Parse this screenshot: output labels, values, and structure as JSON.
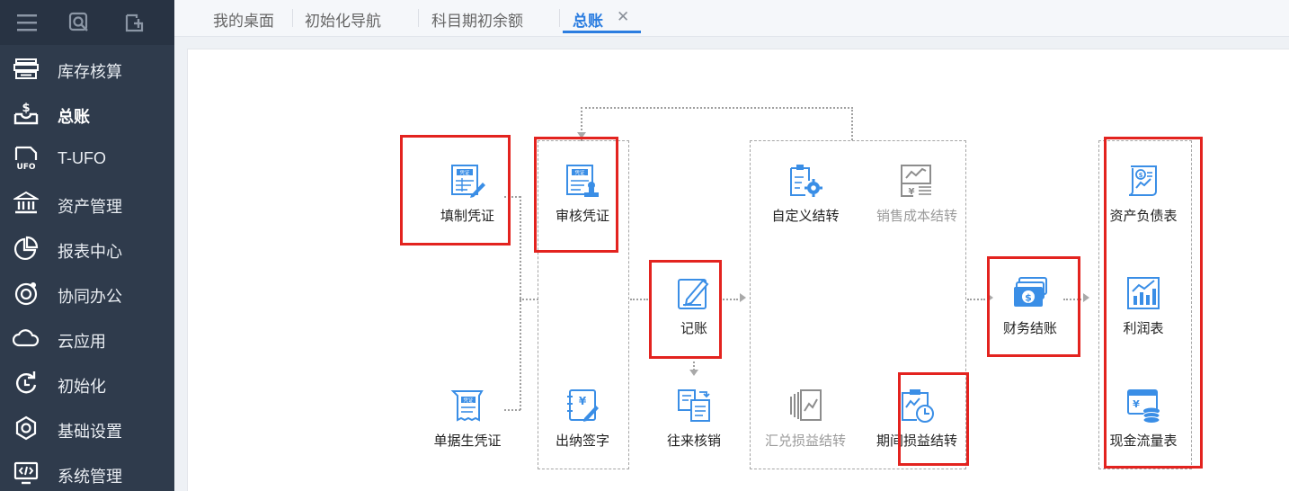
{
  "sidebar": {
    "top_icons": [
      "menu-icon",
      "search-icon",
      "add-page-icon"
    ],
    "items": [
      {
        "label": "库存核算",
        "icon": "inventory-icon"
      },
      {
        "label": "总账",
        "icon": "ledger-icon"
      },
      {
        "label": "T-UFO",
        "icon": "ufo-icon"
      },
      {
        "label": "资产管理",
        "icon": "bank-icon"
      },
      {
        "label": "报表中心",
        "icon": "pie-chart-icon"
      },
      {
        "label": "协同办公",
        "icon": "collab-icon"
      },
      {
        "label": "云应用",
        "icon": "cloud-icon"
      },
      {
        "label": "初始化",
        "icon": "refresh-icon"
      },
      {
        "label": "基础设置",
        "icon": "gear-icon"
      },
      {
        "label": "系统管理",
        "icon": "monitor-code-icon"
      }
    ],
    "active_item": "总账"
  },
  "tabs": [
    {
      "label": "我的桌面"
    },
    {
      "label": "初始化导航"
    },
    {
      "label": "科目期初余额"
    },
    {
      "label": "总账"
    }
  ],
  "active_tab": "总账",
  "tab_close": "✕",
  "flow": {
    "nodes": {
      "fill_voucher": {
        "label": "填制凭证",
        "badge": "凭证"
      },
      "review_voucher": {
        "label": "审核凭证",
        "badge": "凭证"
      },
      "bill_voucher": {
        "label": "单据生凭证",
        "badge": "凭证"
      },
      "cashier_sign": {
        "label": "出纳签字",
        "badge": "¥"
      },
      "post": {
        "label": "记账"
      },
      "reconcile": {
        "label": "往来核销"
      },
      "custom_carry": {
        "label": "自定义结转"
      },
      "sales_cost_carry": {
        "label": "销售成本结转",
        "badge": "¥"
      },
      "fx_carry": {
        "label": "汇兑损益结转"
      },
      "pl_carry": {
        "label": "期间损益结转"
      },
      "close": {
        "label": "财务结账",
        "badge": "$"
      },
      "balance_sheet": {
        "label": "资产负债表",
        "badge": "$"
      },
      "income_statement": {
        "label": "利润表"
      },
      "cashflow": {
        "label": "现金流量表",
        "badge": "¥"
      }
    }
  },
  "colors": {
    "sidebar_bg": "#2f3b4c",
    "accent": "#2b7de0",
    "icon_blue": "#3a8ee6",
    "highlight": "#e3231f",
    "disabled": "#9a9a9a"
  }
}
